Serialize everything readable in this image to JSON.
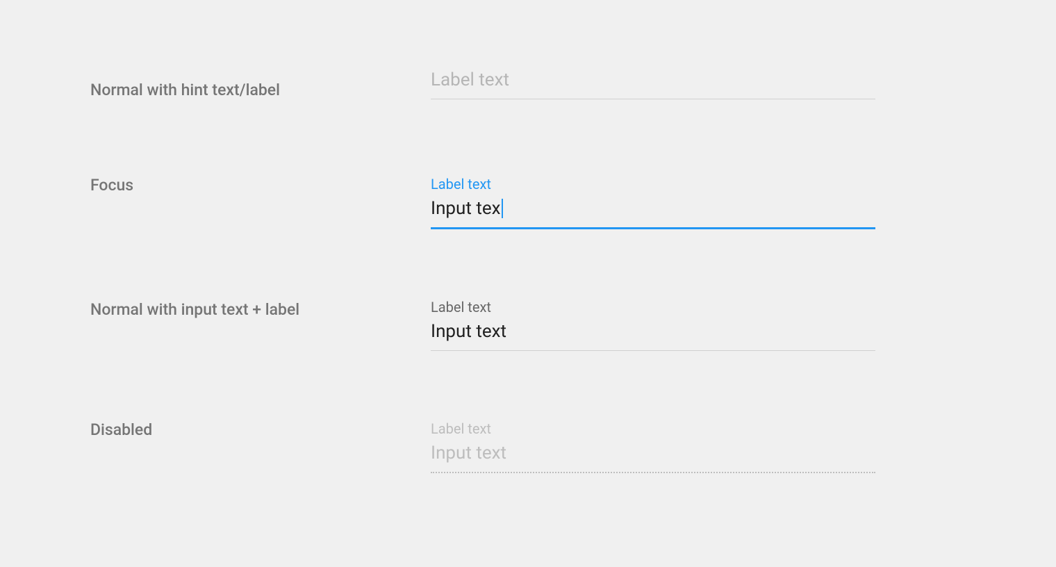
{
  "rows": [
    {
      "caption": "Normal with hint text/label",
      "hint": "Label text"
    },
    {
      "caption": "Focus",
      "label": "Label text",
      "value": "Input tex"
    },
    {
      "caption": "Normal with input text + label",
      "label": "Label text",
      "value": "Input text"
    },
    {
      "caption": "Disabled",
      "label": "Label text",
      "value": "Input text"
    }
  ]
}
